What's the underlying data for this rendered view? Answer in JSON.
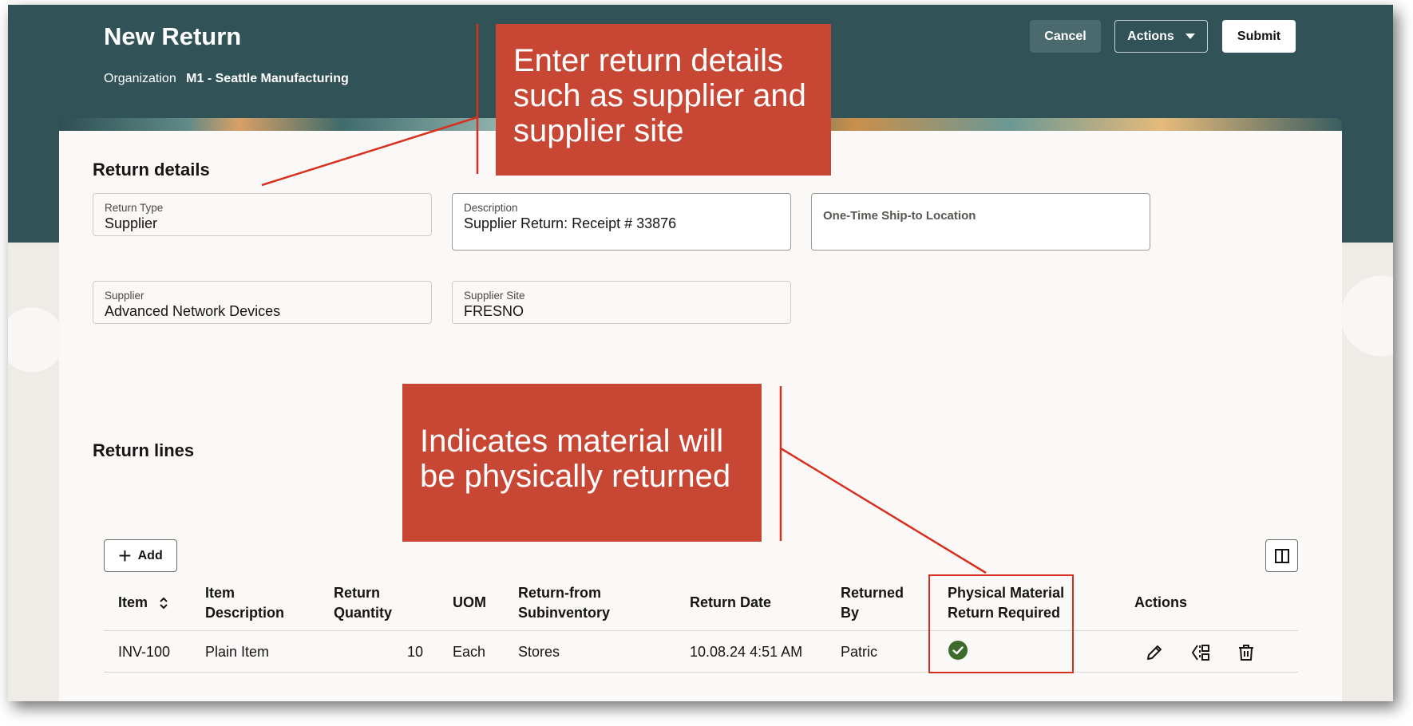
{
  "header": {
    "title": "New Return",
    "organization_label": "Organization",
    "organization_value": "M1 - Seattle Manufacturing",
    "buttons": {
      "cancel": "Cancel",
      "actions": "Actions",
      "submit": "Submit"
    }
  },
  "return_details": {
    "title": "Return details",
    "return_type": {
      "label": "Return Type",
      "value": "Supplier"
    },
    "description": {
      "label": "Description",
      "value": "Supplier Return: Receipt # 33876"
    },
    "ship_to": {
      "placeholder": "One-Time Ship-to Location"
    },
    "supplier": {
      "label": "Supplier",
      "value": "Advanced Network Devices"
    },
    "supplier_site": {
      "label": "Supplier Site",
      "value": "FRESNO"
    }
  },
  "return_lines": {
    "title": "Return lines",
    "add_label": "Add",
    "columns": {
      "item": "Item",
      "item_description": "Item Description",
      "return_quantity": "Return Quantity",
      "uom": "UOM",
      "subinventory": "Return-from Subinventory",
      "return_date": "Return Date",
      "returned_by": "Returned By",
      "physical_return": "Physical Material Return Required",
      "actions": "Actions"
    },
    "rows": [
      {
        "item": "INV-100",
        "item_description": "Plain Item",
        "return_quantity": "10",
        "uom": "Each",
        "subinventory": "Stores",
        "return_date": "10.08.24 4:51 AM",
        "returned_by": "Patric",
        "physical_return_required": true
      }
    ]
  },
  "annotations": {
    "details_callout": "Enter return details such as supplier and supplier site",
    "physical_callout": "Indicates material will be physically returned"
  },
  "colors": {
    "header_band": "#315357",
    "callout": "#c74634",
    "highlight": "#d8301f",
    "check": "#3d6b2e"
  },
  "icons": [
    "sort-icon",
    "plus-icon",
    "columns-icon",
    "check-circle-icon",
    "pencil-icon",
    "split-icon",
    "trash-icon",
    "caret-down-icon"
  ]
}
